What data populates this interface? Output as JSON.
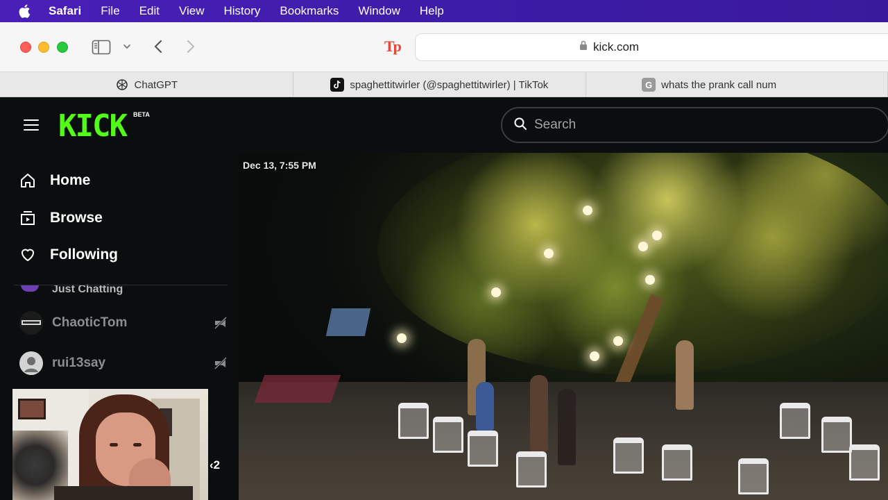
{
  "menubar": {
    "app_name": "Safari",
    "items": [
      "File",
      "Edit",
      "View",
      "History",
      "Bookmarks",
      "Window",
      "Help"
    ],
    "background_color": "#4a1fb8"
  },
  "toolbar": {
    "extension_label": "Tp",
    "url": "kick.com"
  },
  "tabs": [
    {
      "title": "ChatGPT",
      "icon": "chatgpt-icon"
    },
    {
      "title": "spaghettitwirler (@spaghettitwirler) | TikTok",
      "icon": "tiktok-icon"
    },
    {
      "title": "whats the prank call num",
      "icon": "google-icon",
      "icon_letter": "G"
    }
  ],
  "kick": {
    "logo": "KICK",
    "beta": "BETA",
    "brand_color": "#53fc18",
    "search_placeholder": "Search",
    "nav": {
      "home": "Home",
      "browse": "Browse",
      "following": "Following"
    },
    "category": "Just Chatting",
    "channels": [
      {
        "name": "ChaoticTom",
        "status": "offline"
      },
      {
        "name": "rui13say",
        "status": "offline"
      }
    ],
    "webcam_partial_text": "‹2"
  },
  "video": {
    "timestamp": "Dec 13, 7:55 PM"
  }
}
